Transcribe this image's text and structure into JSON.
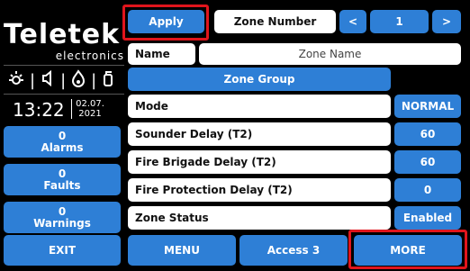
{
  "brand": {
    "name": "Teletek",
    "sub": "electronics"
  },
  "status_icons": [
    "sun-icon",
    "speaker-icon",
    "fire-icon",
    "extinguisher-icon"
  ],
  "clock": {
    "time": "13:22",
    "date_line1": "02.07.",
    "date_line2": "2021"
  },
  "counters": {
    "alarms": {
      "count": "0",
      "label": "Alarms"
    },
    "faults": {
      "count": "0",
      "label": "Faults"
    },
    "warnings": {
      "count": "0",
      "label": "Warnings"
    }
  },
  "topbar": {
    "apply": "Apply",
    "zone_number_label": "Zone Number",
    "prev": "<",
    "zone_number": "1",
    "next": ">"
  },
  "name_row": {
    "label": "Name",
    "value": "Zone Name"
  },
  "zone_group": "Zone Group",
  "rows": [
    {
      "label": "Mode",
      "value": "NORMAL"
    },
    {
      "label": "Sounder Delay (T2)",
      "value": "60"
    },
    {
      "label": "Fire Brigade Delay (T2)",
      "value": "60"
    },
    {
      "label": "Fire Protection Delay (T2)",
      "value": "0"
    },
    {
      "label": "Zone Status",
      "value": "Enabled"
    }
  ],
  "bottom": {
    "exit": "EXIT",
    "menu": "MENU",
    "access": "Access 3",
    "more": "MORE"
  },
  "colors": {
    "accent": "#2e7fd6",
    "highlight": "#e0151c",
    "background": "#000000"
  }
}
